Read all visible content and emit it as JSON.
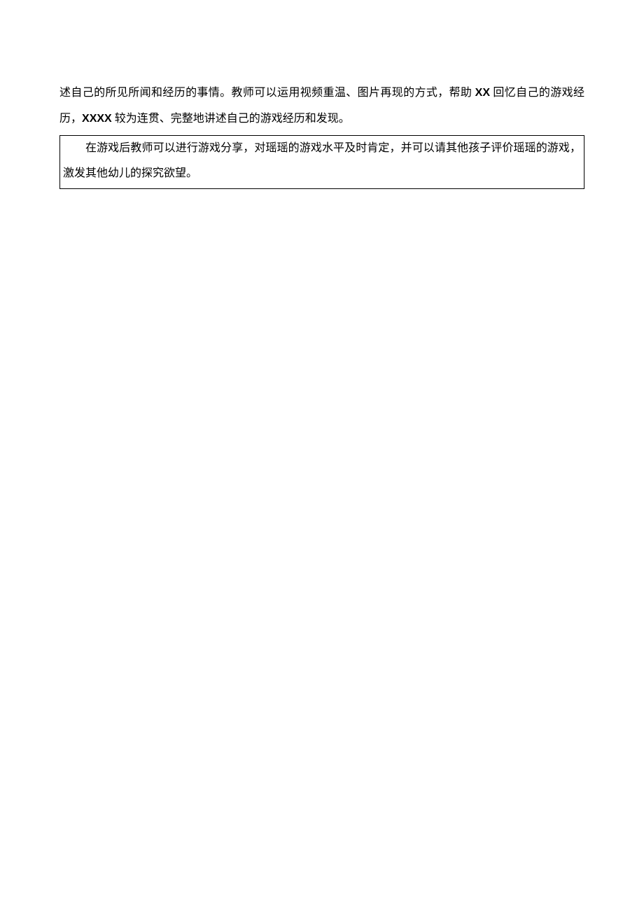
{
  "para1_a": "述自己的所见所闻和经历的事情。教师可以运用视频重温、图片再现的方式，帮助 ",
  "para1_bold1": "XX",
  "para1_b": " 回忆自己的游戏经历，",
  "para1_bold2": "XXXX",
  "para1_c": " 较为连贯、完整地讲述自己的游戏经历和发现。",
  "boxed_text": "在游戏后教师可以进行游戏分享，对瑶瑶的游戏水平及时肯定，并可以请其他孩子评价瑶瑶的游戏，激发其他幼儿的探究欲望。"
}
